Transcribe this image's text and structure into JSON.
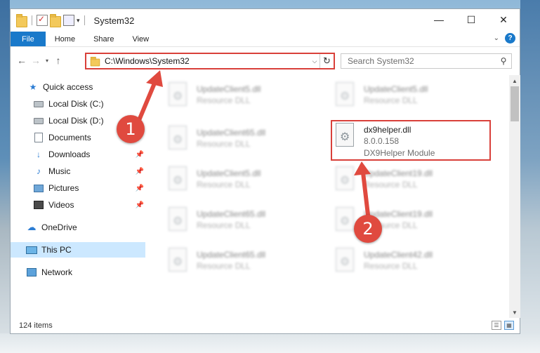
{
  "window": {
    "title": "System32",
    "controls": {
      "minimize": "—",
      "maximize": "☐",
      "close": "✕"
    }
  },
  "ribbon": {
    "tabs": [
      "File",
      "Home",
      "Share",
      "View"
    ],
    "help": "?"
  },
  "navigation": {
    "address": "C:\\Windows\\System32",
    "search_placeholder": "Search System32"
  },
  "sidebar": {
    "items": [
      {
        "label": "Quick access",
        "icon": "star-icon"
      },
      {
        "label": "Local Disk (C:)",
        "icon": "disk-icon"
      },
      {
        "label": "Local Disk (D:)",
        "icon": "disk-icon"
      },
      {
        "label": "Documents",
        "icon": "documents-icon"
      },
      {
        "label": "Downloads",
        "icon": "download-icon",
        "pinned": true
      },
      {
        "label": "Music",
        "icon": "music-icon",
        "pinned": true
      },
      {
        "label": "Pictures",
        "icon": "pictures-icon",
        "pinned": true
      },
      {
        "label": "Videos",
        "icon": "videos-icon",
        "pinned": true
      },
      {
        "label": "OneDrive",
        "icon": "cloud-icon"
      },
      {
        "label": "This PC",
        "icon": "computer-icon",
        "selected": true
      },
      {
        "label": "Network",
        "icon": "network-icon"
      }
    ]
  },
  "files": {
    "left_column": [
      {
        "name": "UpdateClient5.dll",
        "type": "Resource DLL"
      },
      {
        "name": "UpdateClient65.dll",
        "type": "Resource DLL"
      },
      {
        "name": "UpdateClient5.dll",
        "type": "Resource DLL"
      },
      {
        "name": "UpdateClient65.dll",
        "type": "Resource DLL"
      },
      {
        "name": "UpdateClient65.dll",
        "type": "Resource DLL"
      }
    ],
    "right_column": [
      {
        "name": "UpdateClient5.dll",
        "type": "Resource DLL"
      },
      {
        "name": "UpdateClient19.dll",
        "type": "Resource DLL"
      },
      {
        "name": "UpdateClient19.dll",
        "type": "Resource DLL"
      },
      {
        "name": "UpdateClient42.dll",
        "type": "Resource DLL"
      }
    ],
    "highlighted": {
      "name": "dx9helper.dll",
      "version": "8.0.0.158",
      "description": "DX9Helper Module"
    }
  },
  "status": {
    "item_count": "124 items"
  },
  "annotations": {
    "step1": "1",
    "step2": "2",
    "color": "#e04a3f"
  }
}
